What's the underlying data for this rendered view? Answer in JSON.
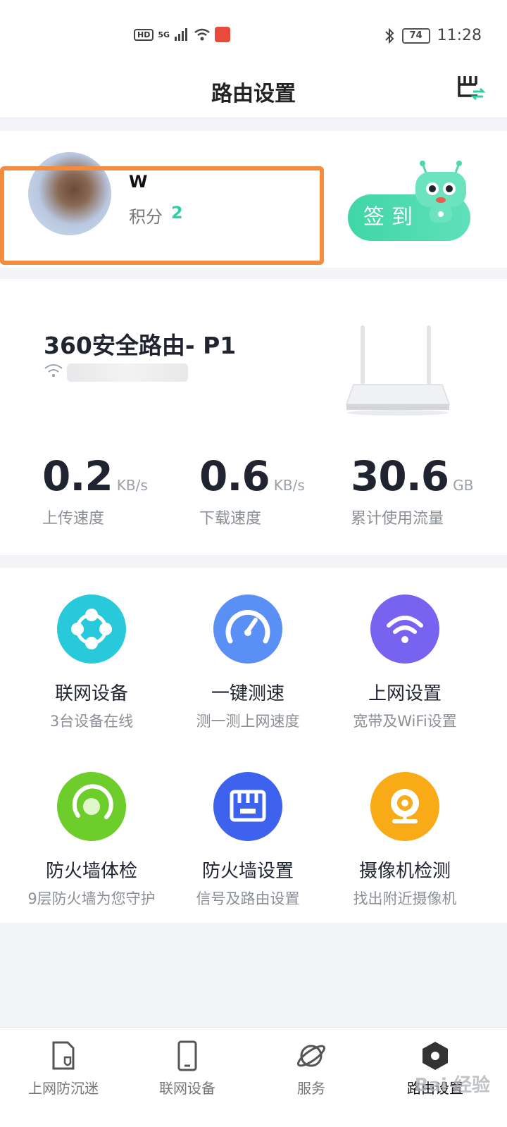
{
  "status_bar": {
    "hd": "HD",
    "network": "5G",
    "battery": "74",
    "time": "11:28"
  },
  "header": {
    "title": "路由设置"
  },
  "profile": {
    "username": "W",
    "points_label": "积分",
    "points_value": "2",
    "checkin_label": "签到"
  },
  "router": {
    "name": "360安全路由- P1",
    "stats": [
      {
        "value": "0.2",
        "unit": "KB/s",
        "label": "上传速度"
      },
      {
        "value": "0.6",
        "unit": "KB/s",
        "label": "下载速度"
      },
      {
        "value": "30.6",
        "unit": "GB",
        "label": "累计使用流量"
      }
    ]
  },
  "features": [
    {
      "title": "联网设备",
      "sub": "3台设备在线",
      "color": "#27c9db",
      "icon": "network-nodes-icon"
    },
    {
      "title": "一键测速",
      "sub": "测一测上网速度",
      "color": "#5a8ff5",
      "icon": "speedometer-icon"
    },
    {
      "title": "上网设置",
      "sub": "宽带及WiFi设置",
      "color": "#7763f0",
      "icon": "wifi-icon"
    },
    {
      "title": "防火墙体检",
      "sub": "9层防火墙为您守护",
      "color": "#6ccd2b",
      "icon": "scan-ring-icon"
    },
    {
      "title": "防火墙设置",
      "sub": "信号及路由设置",
      "color": "#3d63ee",
      "icon": "router-icon"
    },
    {
      "title": "摄像机检测",
      "sub": "找出附近摄像机",
      "color": "#f8aa17",
      "icon": "camera-icon"
    }
  ],
  "bottom_nav": [
    {
      "label": "上网防沉迷",
      "icon": "shield-doc-icon"
    },
    {
      "label": "联网设备",
      "icon": "phone-icon"
    },
    {
      "label": "服务",
      "icon": "planet-icon"
    },
    {
      "label": "路由设置",
      "icon": "hexagon-icon"
    }
  ],
  "watermark": "Bai 经验"
}
